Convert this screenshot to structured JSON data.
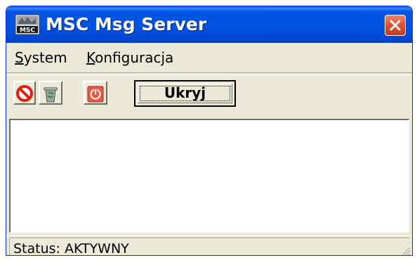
{
  "window": {
    "title": "MSC Msg Server",
    "app_icon": "msc-app-icon",
    "title_color": "#0054e3",
    "close_icon": "close-icon"
  },
  "menu": {
    "items": [
      {
        "label": "System",
        "accel": "S"
      },
      {
        "label": "Konfiguracja",
        "accel": "K"
      }
    ]
  },
  "toolbar": {
    "buttons": [
      {
        "icon": "stop-icon"
      },
      {
        "icon": "recycle-bin-icon"
      },
      {
        "icon": "power-icon"
      }
    ],
    "hide_label": "Ukryj"
  },
  "log": {
    "lines": []
  },
  "status": {
    "text": "Status: AKTYWNY"
  }
}
